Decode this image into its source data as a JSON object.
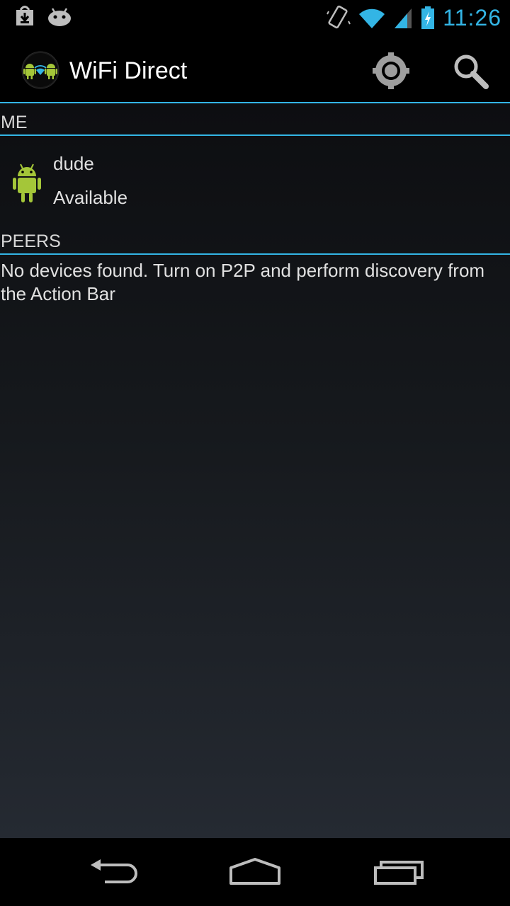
{
  "status_bar": {
    "time": "11:26",
    "icons": [
      "download-icon",
      "android-notification-icon",
      "vibrate-icon",
      "wifi-icon",
      "signal-icon",
      "battery-charging-icon"
    ]
  },
  "action_bar": {
    "title": "WiFi Direct",
    "app_icon": "wifi-direct-app-icon",
    "actions": [
      "settings-icon",
      "search-icon"
    ]
  },
  "me_section": {
    "header": "ME",
    "device": {
      "name": "dude",
      "status": "Available",
      "icon": "android-robot-icon"
    }
  },
  "peers_section": {
    "header": "PEERS",
    "empty_message": "No devices found. Turn on P2P and perform discovery from the Action Bar"
  },
  "navigation": {
    "buttons": [
      "back-icon",
      "home-icon",
      "recents-icon"
    ]
  },
  "colors": {
    "accent": "#33b5e5",
    "android_green": "#a4c639"
  }
}
